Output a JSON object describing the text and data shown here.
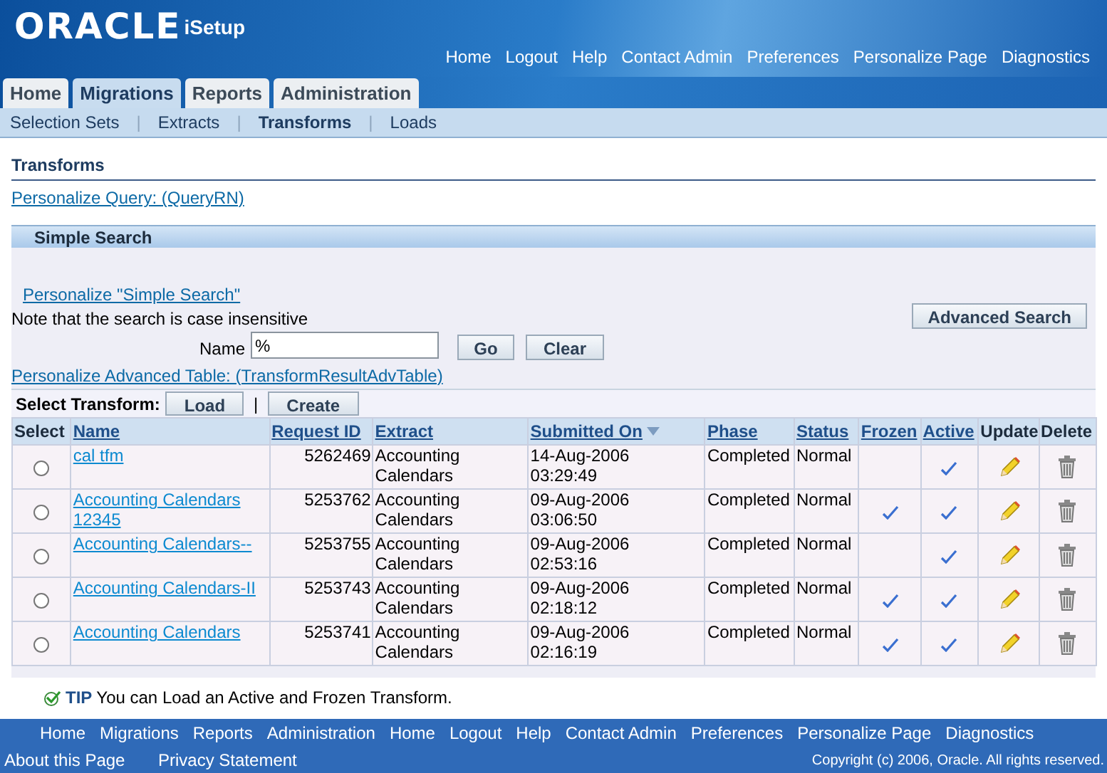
{
  "header": {
    "logo": "ORACLE",
    "product": "iSetup",
    "global_links": [
      "Home",
      "Logout",
      "Help",
      "Contact Admin",
      "Preferences",
      "Personalize Page",
      "Diagnostics"
    ]
  },
  "tabs": [
    {
      "label": "Home",
      "selected": false
    },
    {
      "label": "Migrations",
      "selected": true
    },
    {
      "label": "Reports",
      "selected": false
    },
    {
      "label": "Administration",
      "selected": false
    }
  ],
  "subtabs": [
    {
      "label": "Selection Sets",
      "selected": false
    },
    {
      "label": "Extracts",
      "selected": false
    },
    {
      "label": "Transforms",
      "selected": true
    },
    {
      "label": "Loads",
      "selected": false
    }
  ],
  "subtab_separator": "|",
  "page_title": "Transforms",
  "personalize_query": "Personalize Query: (QueryRN)",
  "search": {
    "title": "Simple Search",
    "personalize_link": "Personalize \"Simple Search\"",
    "note": "Note that the search is case insensitive",
    "advanced_button": "Advanced Search",
    "name_label": "Name",
    "name_value": "%",
    "go_button": "Go",
    "clear_button": "Clear"
  },
  "personalize_table": "Personalize Advanced Table: (TransformResultAdvTable)",
  "table_actions": {
    "label": "Select Transform:",
    "buttons": [
      "Load",
      "Create"
    ],
    "separator": "|"
  },
  "table": {
    "columns": [
      {
        "label": "Select",
        "link": false,
        "sorted": false
      },
      {
        "label": "Name",
        "link": true,
        "sorted": false
      },
      {
        "label": "Request ID",
        "link": true,
        "sorted": false
      },
      {
        "label": "Extract",
        "link": true,
        "sorted": false
      },
      {
        "label": "Submitted On",
        "link": true,
        "sorted": true
      },
      {
        "label": "Phase",
        "link": true,
        "sorted": false
      },
      {
        "label": "Status",
        "link": true,
        "sorted": false
      },
      {
        "label": "Frozen",
        "link": true,
        "sorted": false
      },
      {
        "label": "Active",
        "link": true,
        "sorted": false
      },
      {
        "label": "Update",
        "link": false,
        "sorted": false
      },
      {
        "label": "Delete",
        "link": false,
        "sorted": false
      }
    ],
    "rows": [
      {
        "selected": false,
        "name": "cal tfm",
        "request_id": "5262469",
        "extract": "Accounting Calendars",
        "submitted_on": "14-Aug-2006 03:29:49",
        "phase": "Completed",
        "status": "Normal",
        "frozen": false,
        "active": true
      },
      {
        "selected": false,
        "name": "Accounting Calendars 12345",
        "request_id": "5253762",
        "extract": "Accounting Calendars",
        "submitted_on": "09-Aug-2006 03:06:50",
        "phase": "Completed",
        "status": "Normal",
        "frozen": true,
        "active": true
      },
      {
        "selected": false,
        "name": "Accounting Calendars--",
        "request_id": "5253755",
        "extract": "Accounting Calendars",
        "submitted_on": "09-Aug-2006 02:53:16",
        "phase": "Completed",
        "status": "Normal",
        "frozen": false,
        "active": true
      },
      {
        "selected": false,
        "name": "Accounting Calendars-II",
        "request_id": "5253743",
        "extract": "Accounting Calendars",
        "submitted_on": "09-Aug-2006 02:18:12",
        "phase": "Completed",
        "status": "Normal",
        "frozen": true,
        "active": true
      },
      {
        "selected": false,
        "name": "Accounting Calendars",
        "request_id": "5253741",
        "extract": "Accounting Calendars",
        "submitted_on": "09-Aug-2006 02:16:19",
        "phase": "Completed",
        "status": "Normal",
        "frozen": true,
        "active": true
      }
    ]
  },
  "tip": {
    "label": "TIP",
    "text": "You can Load an Active and Frozen Transform."
  },
  "footer": {
    "links": [
      "Home",
      "Migrations",
      "Reports",
      "Administration",
      "Home",
      "Logout",
      "Help",
      "Contact Admin",
      "Preferences",
      "Personalize Page",
      "Diagnostics"
    ],
    "about": "About this Page",
    "privacy": "Privacy Statement",
    "copyright": "Copyright (c) 2006, Oracle. All rights reserved."
  }
}
